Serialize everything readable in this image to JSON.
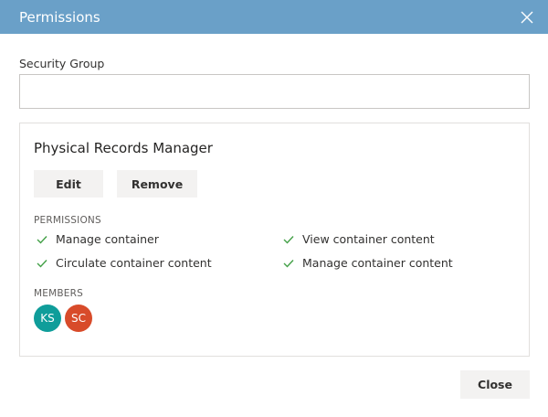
{
  "dialog": {
    "title": "Permissions",
    "close_icon": "close-icon"
  },
  "security_group": {
    "label": "Security Group",
    "value": "",
    "placeholder": ""
  },
  "group_card": {
    "name": "Physical Records Manager",
    "edit_label": "Edit",
    "remove_label": "Remove",
    "permissions_heading": "PERMISSIONS",
    "permissions": [
      {
        "label": "Manage container",
        "icon": "check-icon"
      },
      {
        "label": "View container content",
        "icon": "check-icon"
      },
      {
        "label": "Circulate container content",
        "icon": "check-icon"
      },
      {
        "label": "Manage container content",
        "icon": "check-icon"
      }
    ],
    "members_heading": "MEMBERS",
    "members": [
      {
        "initials": "KS",
        "color": "#0f9d9a"
      },
      {
        "initials": "SC",
        "color": "#d84b2a"
      }
    ]
  },
  "footer": {
    "close_label": "Close"
  },
  "colors": {
    "header": "#6aa0c8",
    "check": "#43a047"
  }
}
